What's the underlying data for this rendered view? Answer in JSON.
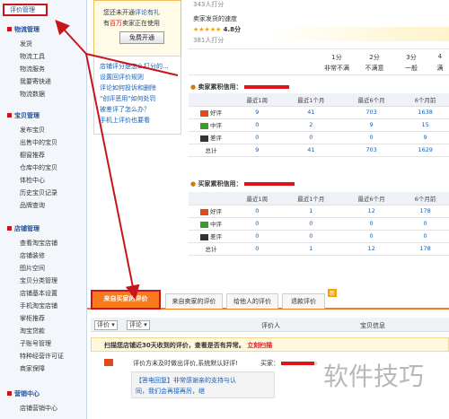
{
  "sidebar": {
    "active": "评价管理",
    "sections": [
      {
        "title": "物流管理",
        "items": [
          "发货",
          "物流工具",
          "物流服务",
          "我要寄快递",
          "物流数据"
        ]
      },
      {
        "title": "宝贝管理",
        "items": [
          "发布宝贝",
          "出售中的宝贝",
          "橱窗推荐",
          "仓库中的宝贝",
          "体检中心",
          "历史宝贝记录",
          "品牌查询"
        ]
      },
      {
        "title": "店铺管理",
        "items": [
          "查看淘宝店铺",
          "店铺装修",
          "图片空间",
          "宝贝分类管理",
          "店铺基本设置",
          "手机淘宝店铺",
          "掌柜推荐",
          "淘宝贷款",
          "子账号管理",
          "特种经营许可证",
          "商家保障"
        ]
      },
      {
        "title": "营销中心",
        "items": [
          "店铺营销中心"
        ]
      }
    ]
  },
  "ad": {
    "line1a": "您还未开通",
    "line1b": "评论有礼",
    "line2a": "有",
    "line2b": "百万",
    "line2c": "卖家正在使用",
    "button": "免费开通"
  },
  "tips": {
    "items": [
      "店铺评分是怎么打分的...",
      "设置回评价规则",
      "评论如何投诉和删除",
      "\"创评恶用\"如何处罚",
      "被差评了怎么办？",
      "手机上评价也要看"
    ]
  },
  "score": {
    "count_top": "343人打分",
    "desc_title": "卖家发货的速度",
    "stars": "★★★★★",
    "value": "4.8分",
    "count": "381人打分",
    "scale": [
      {
        "top": "1分",
        "bottom": "非常不满"
      },
      {
        "top": "2分",
        "bottom": "不满意"
      },
      {
        "top": "3分",
        "bottom": "一般"
      },
      {
        "top": "4",
        "bottom": "满"
      }
    ]
  },
  "seller_credit": {
    "title": "卖家累积信用：",
    "headers": [
      "",
      "最近1周",
      "最近1个月",
      "最近6个月",
      "6个月前"
    ],
    "rows": [
      {
        "label": "好评",
        "values": [
          "9",
          "41",
          "703",
          "1638"
        ]
      },
      {
        "label": "中评",
        "values": [
          "0",
          "2",
          "9",
          "15"
        ]
      },
      {
        "label": "差评",
        "values": [
          "0",
          "0",
          "0",
          "9"
        ]
      },
      {
        "label": "总计",
        "values": [
          "9",
          "41",
          "703",
          "1629"
        ]
      }
    ]
  },
  "buyer_credit": {
    "title": "买家累积信用：",
    "headers": [
      "",
      "最近1周",
      "最近1个月",
      "最近6个月",
      "6个月前"
    ],
    "rows": [
      {
        "label": "好评",
        "values": [
          "0",
          "1",
          "12",
          "178"
        ]
      },
      {
        "label": "中评",
        "values": [
          "0",
          "0",
          "0",
          "0"
        ]
      },
      {
        "label": "差评",
        "values": [
          "0",
          "0",
          "0",
          "0"
        ]
      },
      {
        "label": "总计",
        "values": [
          "0",
          "1",
          "12",
          "178"
        ]
      }
    ]
  },
  "tabs": [
    "来自买家的评价",
    "来自卖家的评价",
    "给他人的评价",
    "退款评价"
  ],
  "tab_badge": "新",
  "list_header": {
    "filter1": "评价",
    "filter2": "评论",
    "col_rater": "评价人",
    "col_item": "宝贝信息"
  },
  "scan_notice": {
    "text": "扫描您店铺近30天收到的评价，查看是否有异常。",
    "link": "立刻扫描"
  },
  "review": {
    "text": "评价方未及时做出评价,系统默认好评!",
    "rater_label": "买家：",
    "tag": "【答电回复】非常感谢亲的支持与认",
    "tag2": "同，我们会再接再厉，继"
  },
  "watermark": "软件技巧",
  "colors": {
    "accent_red": "#c8151a",
    "tab_orange": "#f77a1c",
    "link_blue": "#1a5fb4"
  }
}
